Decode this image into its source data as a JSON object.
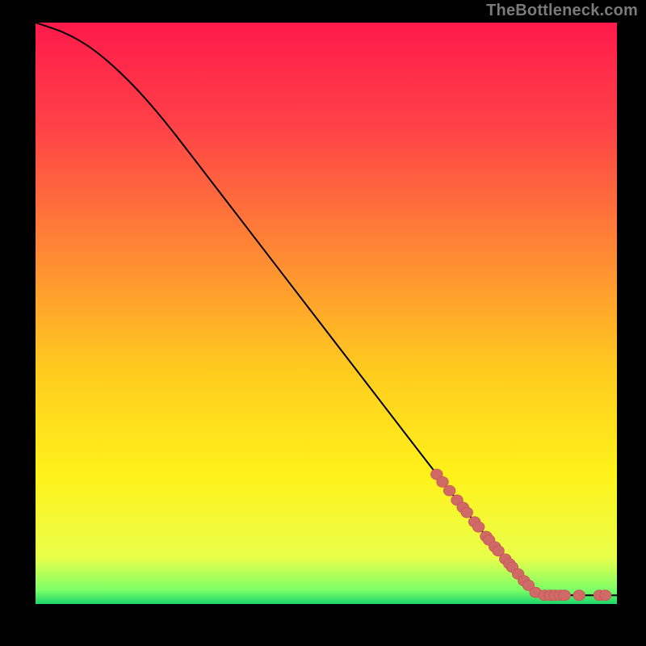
{
  "attribution": "TheBottleneck.com",
  "colors": {
    "curve": "#000000",
    "markerFill": "#d06a67",
    "markerStroke": "#c85b58",
    "gradientStops": [
      {
        "offset": 0.0,
        "color": "#ff1a4b"
      },
      {
        "offset": 0.18,
        "color": "#ff4247"
      },
      {
        "offset": 0.4,
        "color": "#ff8a34"
      },
      {
        "offset": 0.6,
        "color": "#ffcc1e"
      },
      {
        "offset": 0.78,
        "color": "#fff21a"
      },
      {
        "offset": 0.92,
        "color": "#e9ff4a"
      },
      {
        "offset": 0.975,
        "color": "#7fff66"
      },
      {
        "offset": 1.0,
        "color": "#1bd66a"
      }
    ]
  },
  "chart_data": {
    "type": "line",
    "title": "",
    "xlabel": "",
    "ylabel": "",
    "xlim": [
      0,
      100
    ],
    "ylim": [
      0,
      100
    ],
    "grid": false,
    "curve": [
      {
        "x": 0,
        "y": 100
      },
      {
        "x": 6,
        "y": 98
      },
      {
        "x": 12,
        "y": 94
      },
      {
        "x": 20,
        "y": 86
      },
      {
        "x": 30,
        "y": 73
      },
      {
        "x": 40,
        "y": 60
      },
      {
        "x": 50,
        "y": 47
      },
      {
        "x": 60,
        "y": 34
      },
      {
        "x": 70,
        "y": 21
      },
      {
        "x": 78,
        "y": 11
      },
      {
        "x": 84,
        "y": 4
      },
      {
        "x": 86,
        "y": 2
      },
      {
        "x": 88,
        "y": 1.5
      },
      {
        "x": 100,
        "y": 1.5
      }
    ],
    "markers_on_curve_x": [
      69,
      70,
      71.2,
      72.5,
      73.5,
      74.2,
      75.5,
      76.2,
      77.5,
      78,
      79,
      79.6,
      80.8,
      81.5,
      82,
      83,
      84,
      84.8,
      86
    ],
    "markers_flat": [
      {
        "x": 87.5,
        "y": 1.5
      },
      {
        "x": 88.5,
        "y": 1.5
      },
      {
        "x": 89.3,
        "y": 1.5
      },
      {
        "x": 90.2,
        "y": 1.5
      },
      {
        "x": 91,
        "y": 1.5
      },
      {
        "x": 93.5,
        "y": 1.5
      },
      {
        "x": 97,
        "y": 1.5
      },
      {
        "x": 98,
        "y": 1.5
      }
    ]
  }
}
